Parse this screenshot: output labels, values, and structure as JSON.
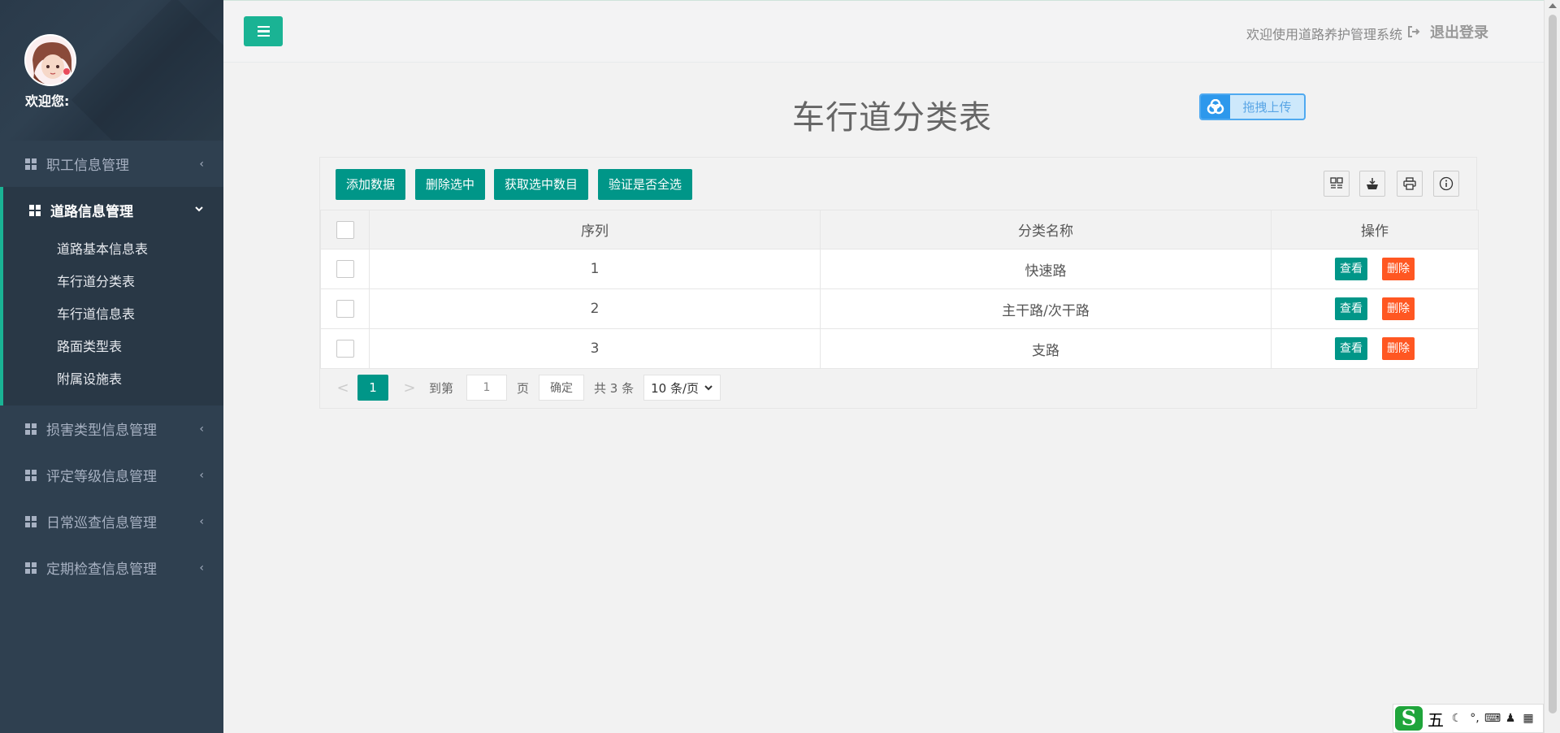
{
  "sidebar": {
    "welcome": "欢迎您:",
    "menu": [
      {
        "label": "职工信息管理"
      },
      {
        "label": "道路信息管理",
        "open": true,
        "children": [
          "道路基本信息表",
          "车行道分类表",
          "车行道信息表",
          "路面类型表",
          "附属设施表"
        ]
      },
      {
        "label": "损害类型信息管理"
      },
      {
        "label": "评定等级信息管理"
      },
      {
        "label": "日常巡查信息管理"
      },
      {
        "label": "定期检查信息管理"
      }
    ]
  },
  "topbar": {
    "welcome_text": "欢迎使用道路养护管理系统",
    "logout_label": "退出登录"
  },
  "page": {
    "title": "车行道分类表",
    "upload_label": "拖拽上传"
  },
  "toolbar": {
    "add": "添加数据",
    "delete_selected": "删除选中",
    "get_selected_count": "获取选中数目",
    "verify_all": "验证是否全选"
  },
  "table": {
    "headers": [
      "序列",
      "分类名称",
      "操作"
    ],
    "rows": [
      {
        "index": "1",
        "name": "快速路"
      },
      {
        "index": "2",
        "name": "主干路/次干路"
      },
      {
        "index": "3",
        "name": "支路"
      }
    ],
    "view_label": "查看",
    "delete_label": "删除"
  },
  "pager": {
    "prev": "<",
    "current": "1",
    "next": ">",
    "goto_label": "到第",
    "goto_value": "1",
    "page_label": "页",
    "confirm": "确定",
    "total": "共 3 条",
    "page_size": "10 条/页"
  },
  "tray": {
    "ime_char": "五"
  },
  "colors": {
    "sidebar_bg": "#2f4050",
    "accent": "#1ab394",
    "primary": "#009688",
    "danger": "#ff5722"
  }
}
